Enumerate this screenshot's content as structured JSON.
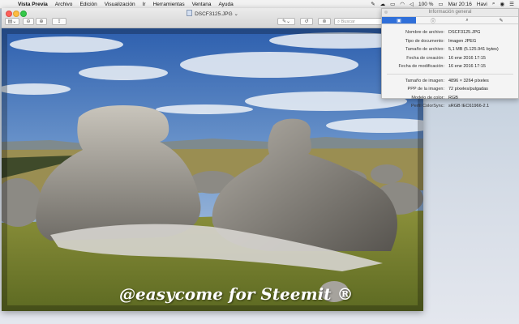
{
  "menubar": {
    "app_name": "Vista Previa",
    "items": [
      "Archivo",
      "Edición",
      "Visualización",
      "Ir",
      "Herramientas",
      "Ventana",
      "Ayuda"
    ],
    "clock": "Mar 20:16",
    "user": "Havi",
    "battery": "100 %"
  },
  "window": {
    "title": "DSCF3125.JPG",
    "search_placeholder": "Buscar"
  },
  "photo": {
    "watermark": "@easycome for Steemit ®"
  },
  "info_panel": {
    "title": "Información general",
    "rows_general": [
      {
        "key": "Nombre de archivo:",
        "value": "DSCF3125.JPG"
      },
      {
        "key": "Tipo de documento:",
        "value": "Imagen JPEG"
      },
      {
        "key": "Tamaño de archivo:",
        "value": "5,1 MB (5.125.941 bytes)"
      },
      {
        "key": "Fecha de creación:",
        "value": "16 ene 2016 17:15"
      },
      {
        "key": "Fecha de modificación:",
        "value": "16 ene 2016 17:15"
      }
    ],
    "rows_image": [
      {
        "key": "Tamaño de imagen:",
        "value": "4896 × 3264 píxeles"
      },
      {
        "key": "PPP de la imagen:",
        "value": "72 píxeles/pulgadas"
      },
      {
        "key": "Modelo de color:",
        "value": "RGB"
      },
      {
        "key": "Perfil ColorSync:",
        "value": "sRGB IEC61966-2.1"
      }
    ]
  }
}
